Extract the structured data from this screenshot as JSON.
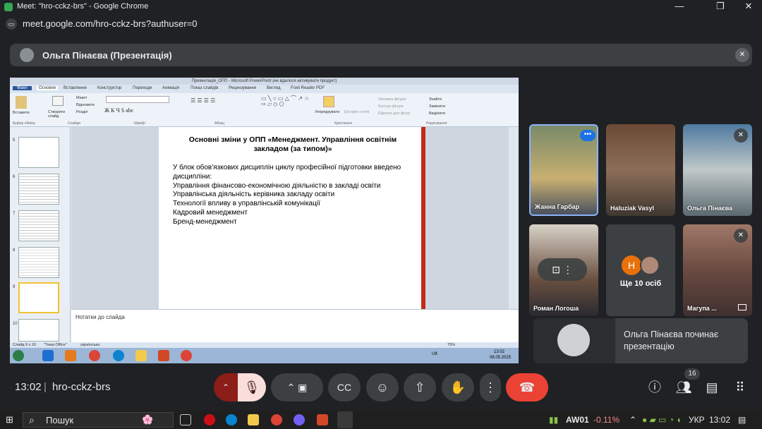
{
  "browser": {
    "title": "Meet: \"hro-cckz-brs\" - Google Chrome",
    "url": "meet.google.com/hro-cckz-brs?authuser=0"
  },
  "presenter": {
    "name": "Ольга Пінаєва (Презентація)"
  },
  "powerpoint": {
    "title": "Презентація_ОПП - Microsoft PowerPoint (не вдалося активувати продукт)",
    "tabs": [
      "Файл",
      "Основне",
      "Вставлення",
      "Конструктор",
      "Переходи",
      "Анімація",
      "Показ слайдів",
      "Рецензування",
      "Вигляд",
      "Foxit Reader PDF"
    ],
    "ribbon": {
      "paste": "Вставити",
      "layout": "Макет",
      "reset": "Відновити",
      "section": "Розділ",
      "new_slide": "Створити слайд",
      "arrange": "Упорядкувати",
      "quick_styles": "Експрес-стилі",
      "shape_fill": "Заливка фігури",
      "shape_outline": "Контур фігури",
      "shape_effects": "Ефекти для фігур",
      "find": "Знайти",
      "replace": "Замінити",
      "select": "Виділити",
      "groups": [
        "Буфер обміну",
        "Слайди",
        "Шрифт",
        "Абзац",
        "Креслення",
        "Редагування"
      ]
    },
    "thumb_numbers": [
      "5",
      "6",
      "7",
      "8",
      "9",
      "10"
    ],
    "slide": {
      "title": "Основні зміни у ОПП «Менеджмент. Управління освітнім закладом (за типом)»",
      "lines": [
        "У блок обов'язкових дисциплін циклу професійної підготовки введено дисципліни:",
        "Управління фінансово-економічною діяльністю в закладі освіти",
        "Управлінська діяльність керівника закладу освіти",
        "Технології впливу в управлінській комунікації",
        "Кадровий менеджмент",
        "Бренд-менеджмент"
      ]
    },
    "notes_placeholder": "Нотатки до слайда",
    "status": {
      "slide": "Слайд 9 з 10",
      "theme": "\"Тема Office\"",
      "lang": "українська",
      "zoom": "75%"
    },
    "tray": {
      "lang": "UK",
      "time": "13:02",
      "date": "08.05.2025"
    }
  },
  "participants": [
    {
      "name": "Жанна Гарбар",
      "muted": false,
      "more": true
    },
    {
      "name": "Haluziak Vasyl",
      "muted": false
    },
    {
      "name": "Ольга Пінаєва",
      "muted": true
    },
    {
      "name": "Роман Логоша",
      "muted": false
    },
    {
      "name": "Ще 10 осіб",
      "avatar_letter": "Н"
    },
    {
      "name": "Магупа ...",
      "muted": true
    }
  ],
  "notification": {
    "text": "Ольга Пінаєва починає презентацію"
  },
  "controls": {
    "time": "13:02",
    "separator": "|",
    "meeting_code": "hro-cckz-brs",
    "participants_count": "16"
  },
  "taskbar": {
    "search_placeholder": "Пошук",
    "ticker": "AW01",
    "ticker_change": "-0.11%",
    "lang": "УКР",
    "time": "13:02"
  },
  "colors": {
    "bg": "#202124",
    "surface": "#3c4043",
    "hangup": "#ea4335",
    "mic_muted": "#f9dedc",
    "ticker_negative": "#f28b82"
  }
}
